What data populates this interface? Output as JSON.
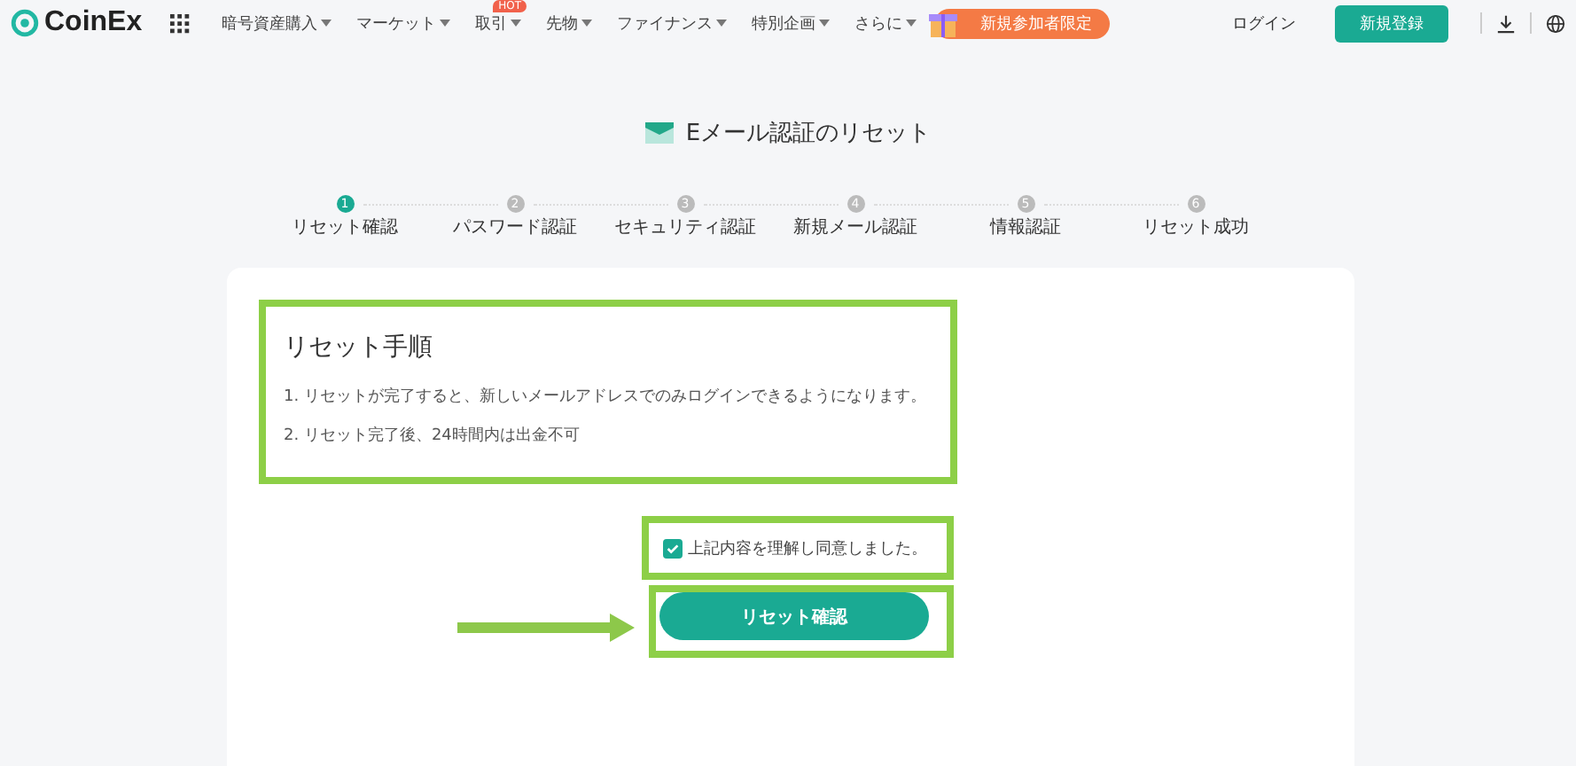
{
  "header": {
    "logo": "CoinEx",
    "nav": [
      {
        "label": "暗号資産購入"
      },
      {
        "label": "マーケット"
      },
      {
        "label": "取引",
        "badge": "HOT"
      },
      {
        "label": "先物"
      },
      {
        "label": "ファイナンス"
      },
      {
        "label": "特別企画"
      },
      {
        "label": "さらに"
      }
    ],
    "promo": "新規参加者限定",
    "login": "ログイン",
    "signup": "新規登録"
  },
  "title": "Eメール認証のリセット",
  "steps": [
    {
      "number": "1",
      "label": "リセット確認",
      "selected": true
    },
    {
      "number": "2",
      "label": "パスワード認証",
      "selected": false
    },
    {
      "number": "3",
      "label": "セキュリティ認証",
      "selected": false
    },
    {
      "number": "4",
      "label": "新規メール認証",
      "selected": false
    },
    {
      "number": "5",
      "label": "情報認証",
      "selected": false
    },
    {
      "number": "6",
      "label": "リセット成功",
      "selected": false
    }
  ],
  "notice": {
    "heading": "リセット手順",
    "items": [
      "1. リセットが完了すると、新しいメールアドレスでのみログインできるようになります。",
      "2. リセット完了後、24時間内は出金不可"
    ]
  },
  "agreement": {
    "label": "上記内容を理解し同意しました。",
    "checked": true
  },
  "confirm_button": "リセット確認"
}
